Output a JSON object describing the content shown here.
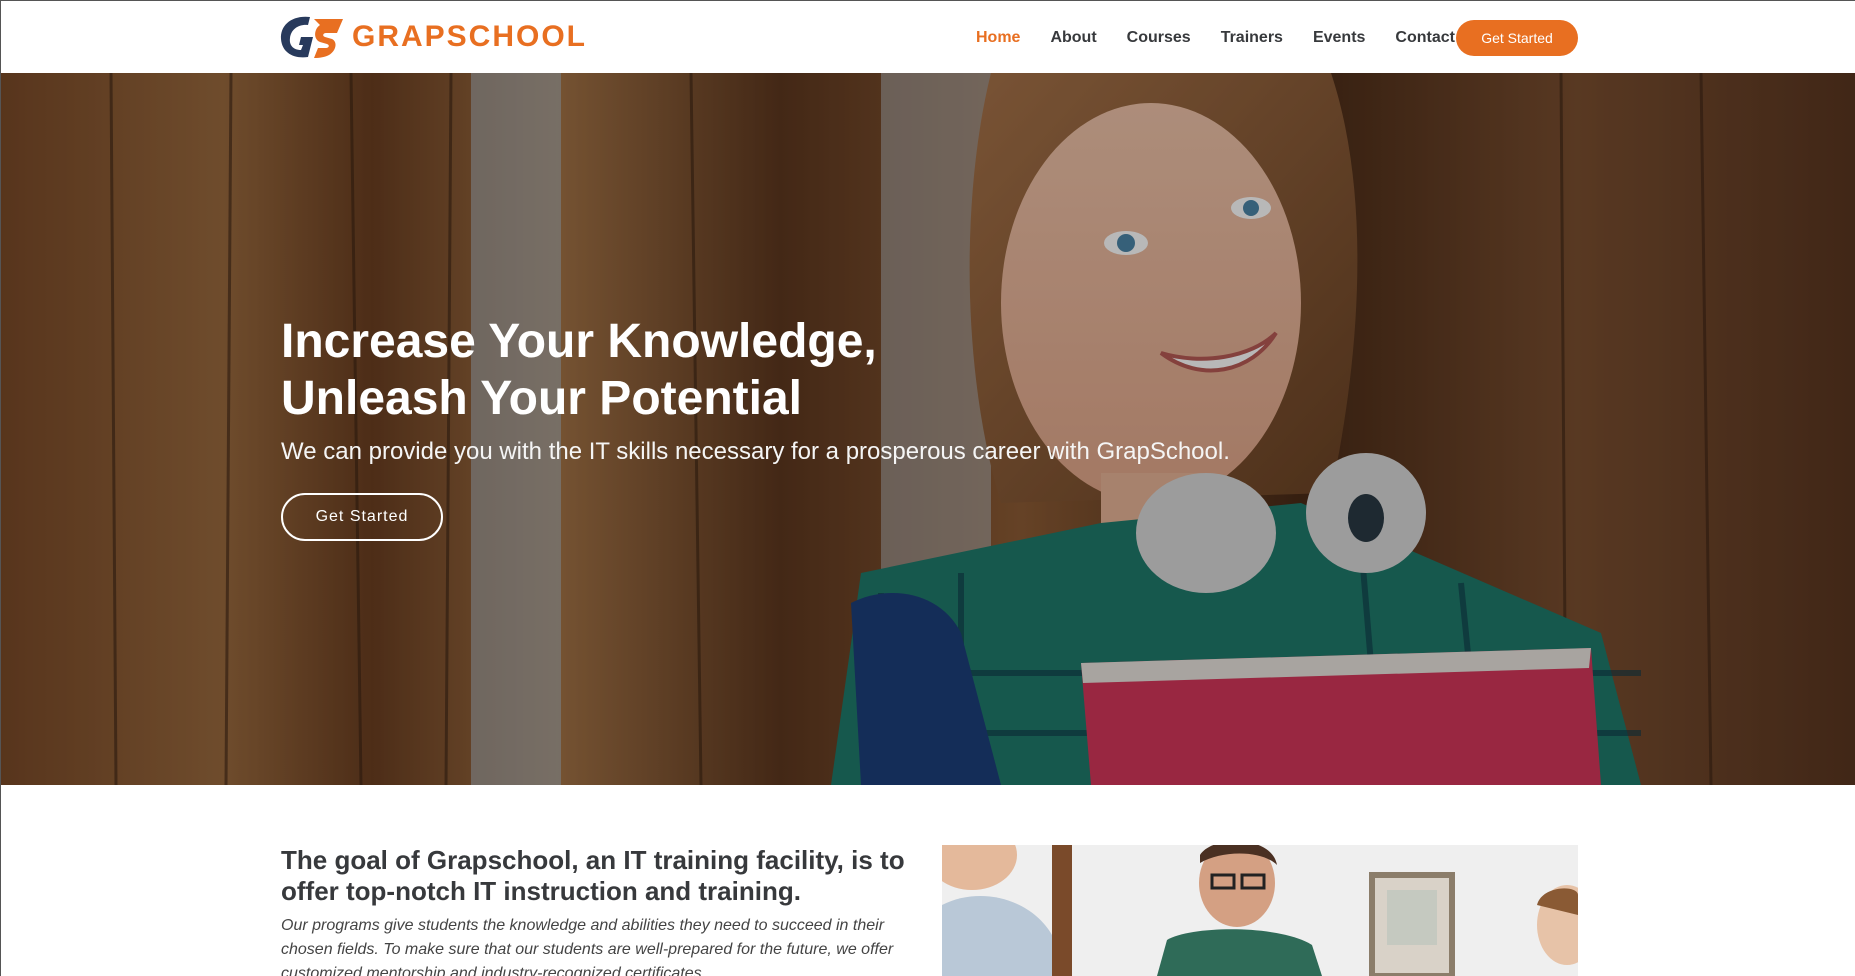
{
  "brand": {
    "name": "GRAPSCHOOL",
    "primary_color": "#e86f21",
    "logo_mark_color": "#283a5c",
    "logo_icon": "gs-logo-icon"
  },
  "nav": {
    "items": [
      {
        "label": "Home",
        "active": true
      },
      {
        "label": "About",
        "active": false
      },
      {
        "label": "Courses",
        "active": false
      },
      {
        "label": "Trainers",
        "active": false
      },
      {
        "label": "Events",
        "active": false
      },
      {
        "label": "Contact",
        "active": false
      }
    ],
    "cta_label": "Get Started"
  },
  "hero": {
    "title_line1": "Increase Your Knowledge,",
    "title_line2": "Unleash Your Potential",
    "subtitle": "We can provide you with the IT skills necessary for a prosperous career with GrapSchool.",
    "button_label": "Get Started"
  },
  "about": {
    "heading": "The goal of Grapschool, an IT training facility, is to offer top-notch IT instruction and training.",
    "text": "Our programs give students the knowledge and abilities they need to succeed in their chosen fields. To make sure that our students are well-prepared for the future, we offer customized mentorship and industry-recognized certificates."
  }
}
